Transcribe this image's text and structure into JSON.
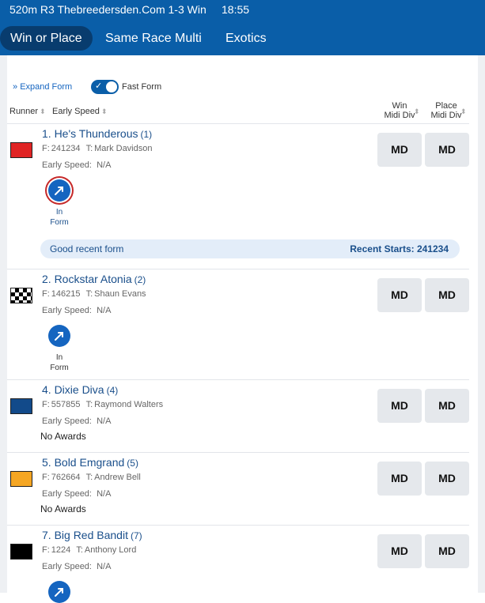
{
  "header": {
    "race_title": "520m R3 Thebreedersden.Com 1-3 Win",
    "time": "18:55",
    "tabs": [
      {
        "label": "Win or Place",
        "active": true
      },
      {
        "label": "Same Race Multi",
        "active": false
      },
      {
        "label": "Exotics",
        "active": false
      }
    ]
  },
  "controls": {
    "expand_form": "Expand Form",
    "fast_form": "Fast Form",
    "fast_form_on": true
  },
  "columns": {
    "runner": "Runner",
    "early_speed": "Early Speed",
    "win_line1": "Win",
    "win_line2": "Midi Div",
    "place_line1": "Place",
    "place_line2": "Midi Div"
  },
  "runners": [
    {
      "name": "1. He's Thunderous",
      "box": "(1)",
      "form_label": "F:",
      "form": "241234",
      "trainer_label": "T:",
      "trainer": "Mark Davidson",
      "speed_label": "Early Speed:",
      "speed": "N/A",
      "silk_color": "#e02424",
      "in_form_line1": "In",
      "in_form_line2": "Form",
      "win": "MD",
      "place": "MD",
      "banner_text": "Good recent form",
      "banner_starts": "Recent Starts: 241234"
    },
    {
      "name": "2. Rockstar Atonia",
      "box": "(2)",
      "form_label": "F:",
      "form": "146215",
      "trainer_label": "T:",
      "trainer": "Shaun Evans",
      "speed_label": "Early Speed:",
      "speed": "N/A",
      "silk_color": "checkered",
      "in_form_line1": "In",
      "in_form_line2": "Form",
      "win": "MD",
      "place": "MD"
    },
    {
      "name": "4. Dixie Diva",
      "box": "(4)",
      "form_label": "F:",
      "form": "557855",
      "trainer_label": "T:",
      "trainer": "Raymond Walters",
      "speed_label": "Early Speed:",
      "speed": "N/A",
      "silk_color": "#124a8a",
      "awards": "No Awards",
      "win": "MD",
      "place": "MD"
    },
    {
      "name": "5. Bold Emgrand",
      "box": "(5)",
      "form_label": "F:",
      "form": "762664",
      "trainer_label": "T:",
      "trainer": "Andrew Bell",
      "speed_label": "Early Speed:",
      "speed": "N/A",
      "silk_color": "#f5a623",
      "awards": "No Awards",
      "win": "MD",
      "place": "MD"
    },
    {
      "name": "7. Big Red Bandit",
      "box": "(7)",
      "form_label": "F:",
      "form": "1224",
      "trainer_label": "T:",
      "trainer": "Anthony Lord",
      "speed_label": "Early Speed:",
      "speed": "N/A",
      "silk_color": "#000000",
      "win": "MD",
      "place": "MD"
    }
  ],
  "colors": {
    "brand_blue": "#0a5ea8",
    "active_tab": "#083c6e",
    "link_blue": "#1a4f8b"
  }
}
